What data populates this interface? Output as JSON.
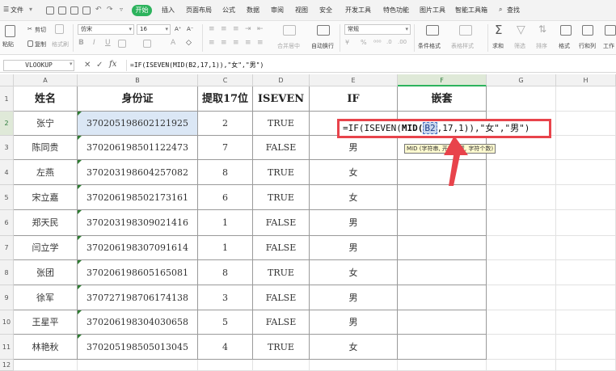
{
  "menu": {
    "file_label": "文件",
    "tabs": [
      "开始",
      "插入",
      "页面布局",
      "公式",
      "数据",
      "审阅",
      "视图",
      "安全",
      "开发工具",
      "特色功能",
      "图片工具",
      "智能工具箱"
    ],
    "search_label": "查找",
    "accent_color": "#2db35d"
  },
  "ribbon": {
    "cut_label": "剪切",
    "paste_label": "粘贴",
    "copy_label": "复制",
    "format_painter_label": "格式刷",
    "font_name": "仿宋",
    "font_size": "16",
    "bold_label": "B",
    "italic_label": "I",
    "underline_label": "U",
    "grow_font_label": "A⁺",
    "shrink_font_label": "A⁻",
    "merge_center_label": "合并居中",
    "wrap_text_label": "自动换行",
    "number_format": "常规",
    "conditional_format_label": "条件格式",
    "table_style_label": "表格样式",
    "sum_label": "求和",
    "filter_label": "筛选",
    "sort_label": "排序",
    "format_label": "格式",
    "row_col_label": "行和列",
    "worksheet_label": "工作"
  },
  "formula_bar": {
    "name_box": "VLOOKUP",
    "cancel_glyph": "✕",
    "confirm_glyph": "✓",
    "fx_label": "fx",
    "formula": "=IF(ISEVEN(MID(B2,17,1)),\"女\",\"男\")"
  },
  "editing": {
    "part1": "=IF(ISEVEN(",
    "part2": "MID(",
    "part3": "B2",
    "part4": ",17,1)),\"女\",\"男\")",
    "tooltip": "MID (字符串, 开始位置, 字符个数)",
    "arrow_color": "#e8434b"
  },
  "grid": {
    "columns": [
      "A",
      "B",
      "C",
      "D",
      "E",
      "F",
      "G",
      "H"
    ],
    "rows": [
      "1",
      "2",
      "3",
      "4",
      "5",
      "6",
      "7",
      "8",
      "9",
      "10",
      "11",
      "12"
    ],
    "headers": [
      "姓名",
      "身份证",
      "提取17位",
      "ISEVEN",
      "IF",
      "嵌套"
    ],
    "data": [
      [
        "张宁",
        "370205198602121925",
        "2",
        "TRUE",
        ""
      ],
      [
        "陈同贵",
        "370206198501122473",
        "7",
        "FALSE",
        "男"
      ],
      [
        "左燕",
        "370203198604257082",
        "8",
        "TRUE",
        "女"
      ],
      [
        "宋立嘉",
        "370206198502173161",
        "6",
        "TRUE",
        "女"
      ],
      [
        "郑天民",
        "370203198309021416",
        "1",
        "FALSE",
        "男"
      ],
      [
        "闫立学",
        "370206198307091614",
        "1",
        "FALSE",
        "男"
      ],
      [
        "张团",
        "370206198605165081",
        "8",
        "TRUE",
        "女"
      ],
      [
        "徐军",
        "370727198706174138",
        "3",
        "FALSE",
        "男"
      ],
      [
        "王星平",
        "370206198304030658",
        "5",
        "FALSE",
        "男"
      ],
      [
        "林艳秋",
        "370205198505013045",
        "4",
        "TRUE",
        "女"
      ]
    ]
  }
}
